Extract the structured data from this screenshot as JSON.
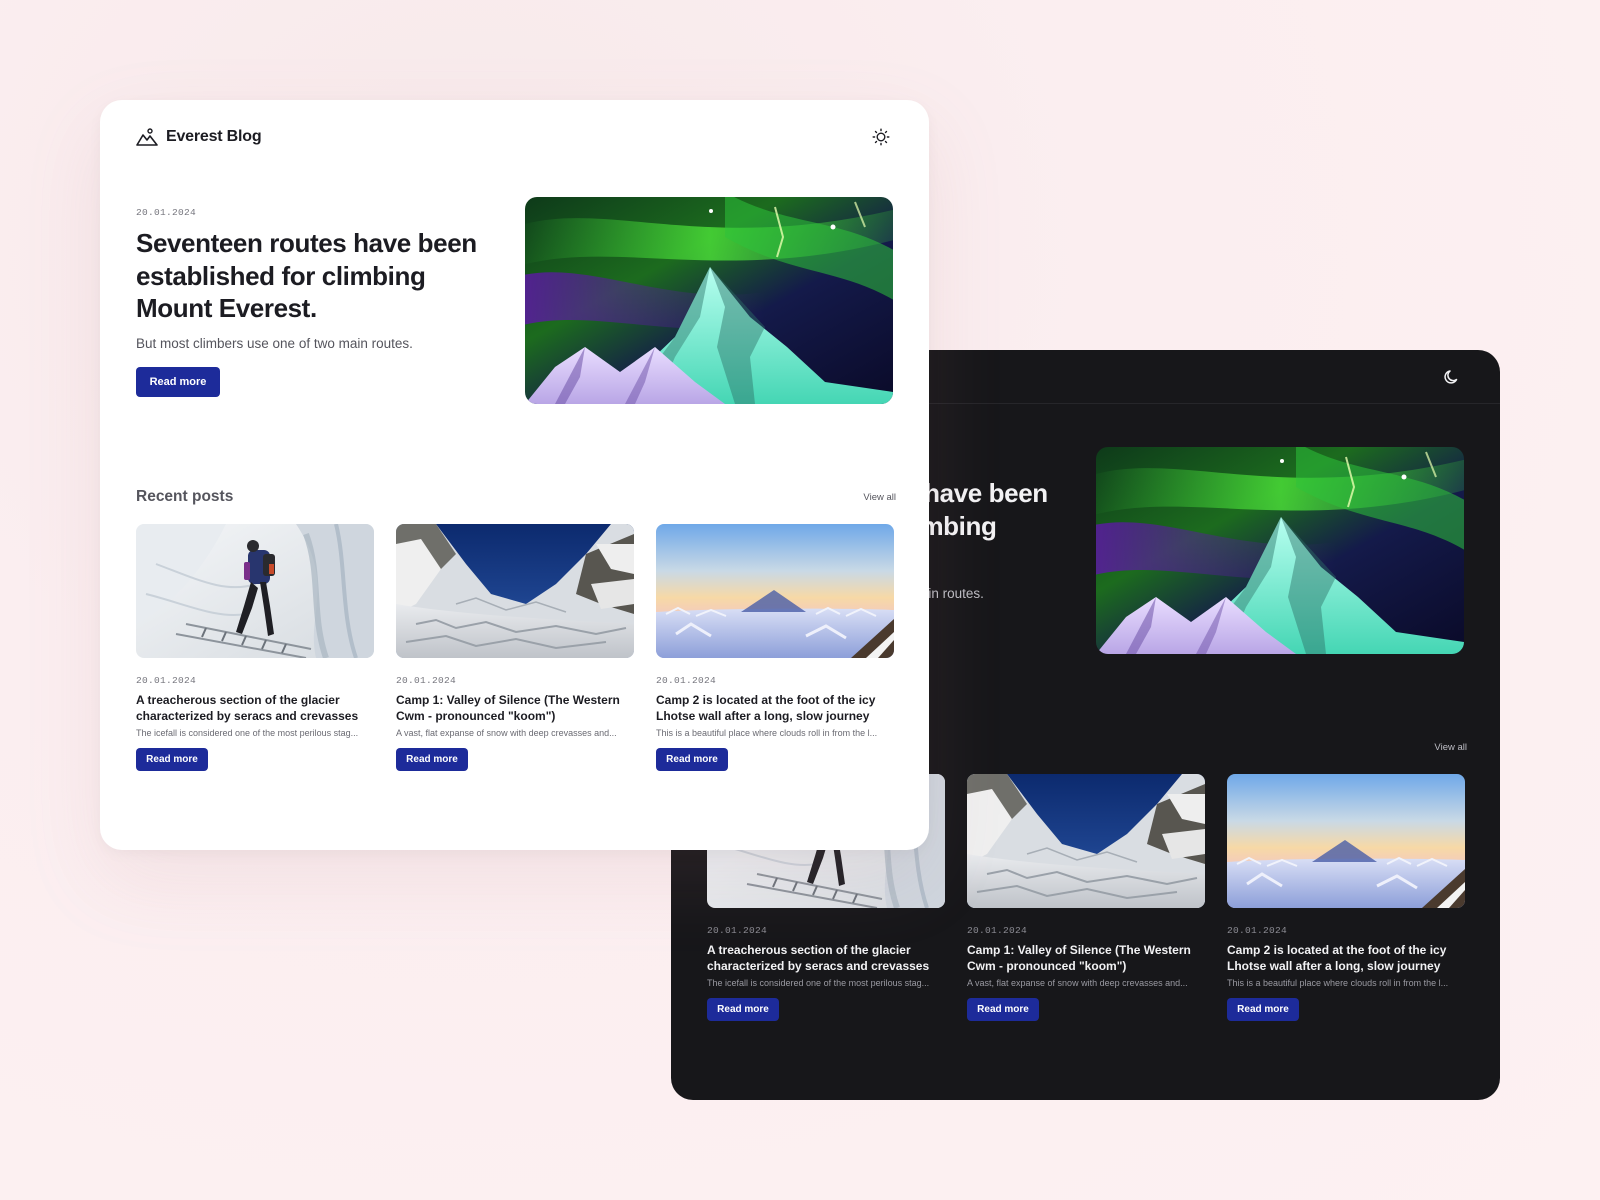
{
  "brand": {
    "name": "Everest Blog",
    "logo_icon": "mountain-icon"
  },
  "modes": {
    "light_icon": "sun-icon",
    "dark_icon": "moon-icon"
  },
  "hero": {
    "date": "20.01.2024",
    "title": "Seventeen routes have been established for climbing Mount Everest.",
    "subtitle": "But most climbers use one of two main routes.",
    "cta": "Read more"
  },
  "recent": {
    "title": "Recent posts",
    "view_all": "View all",
    "posts": [
      {
        "date": "20.01.2024",
        "title": "A treacherous section of the glacier characterized by seracs and crevasses t...",
        "desc": "The icefall is considered one of the most perilous stag...",
        "cta": "Read more"
      },
      {
        "date": "20.01.2024",
        "title": "Camp 1: Valley of Silence (The Western Cwm - pronounced \"koom\")",
        "desc": "A vast, flat expanse of snow with deep crevasses and...",
        "cta": "Read more"
      },
      {
        "date": "20.01.2024",
        "title": "Camp 2 is located at the foot of the icy Lhotse wall after a long, slow journey thr...",
        "desc": "This is a beautiful place where clouds roll in from the l...",
        "cta": "Read more"
      }
    ]
  },
  "colors": {
    "accent": "#1d2b9a",
    "dark_bg": "#17171a",
    "light_bg": "#ffffff"
  }
}
